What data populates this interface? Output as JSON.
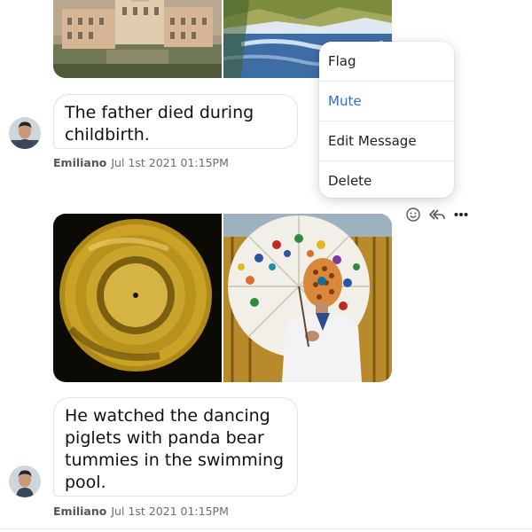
{
  "messages": [
    {
      "text": "The father died during childbirth.",
      "author": "Emiliano",
      "timestamp": "Jul 1st 2021 01:15PM",
      "attachments": [
        "palace-photo",
        "lake-mountain-photo"
      ]
    },
    {
      "text": "He watched the dancing piglets with panda bear tummies in the swimming pool.",
      "author": "Emiliano",
      "timestamp": "Jul 1st 2021 01:15PM",
      "attachments": [
        "golden-record-photo",
        "umbrella-mask-photo"
      ]
    }
  ],
  "context_menu": {
    "items": [
      {
        "label": "Flag"
      },
      {
        "label": "Mute",
        "active": true
      },
      {
        "label": "Edit Message"
      },
      {
        "label": "Delete"
      }
    ]
  },
  "message_actions": {
    "icons": [
      "smiley-icon",
      "reply-all-icon",
      "more-options-icon"
    ]
  },
  "colors": {
    "menu_active": "#2f6ed8",
    "meta_text": "#6d6d6d",
    "bubble_border": "#e2e2e2"
  }
}
